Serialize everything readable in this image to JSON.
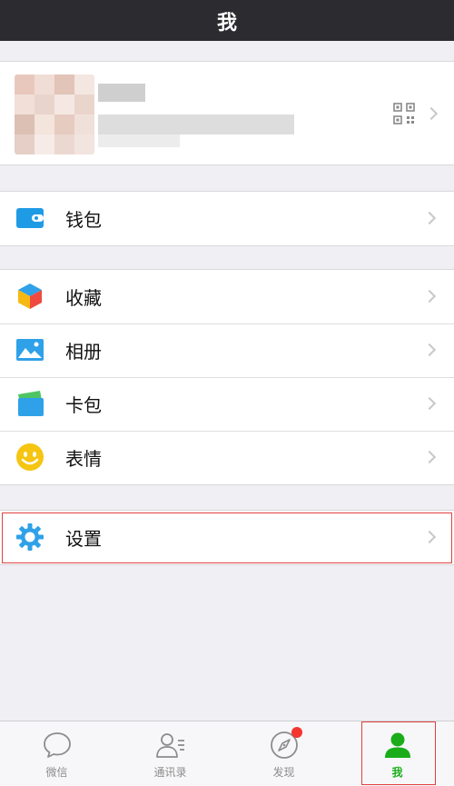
{
  "header": {
    "title": "我"
  },
  "menu": {
    "wallet": "钱包",
    "favorites": "收藏",
    "album": "相册",
    "cards": "卡包",
    "stickers": "表情",
    "settings": "设置"
  },
  "tabbar": {
    "chats": "微信",
    "contacts": "通讯录",
    "discover": "发现",
    "me": "我"
  },
  "colors": {
    "nav_bg": "#2c2b30",
    "active_tab": "#1aad19",
    "highlight": "#e04040",
    "badge": "#f43530"
  }
}
